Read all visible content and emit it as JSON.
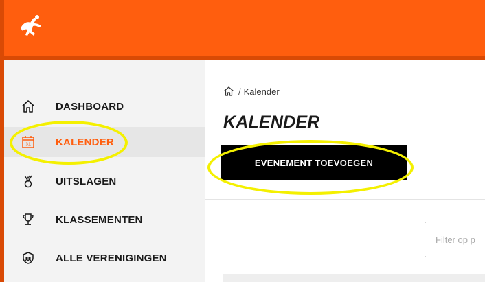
{
  "header": {
    "logo_icon": "athlete-logo-icon",
    "brand_color": "#ff5e0e"
  },
  "sidebar": {
    "items": [
      {
        "label": "DASHBOARD",
        "icon": "home-icon"
      },
      {
        "label": "KALENDER",
        "icon": "calendar-icon",
        "active": true
      },
      {
        "label": "UITSLAGEN",
        "icon": "medal-icon"
      },
      {
        "label": "KLASSEMENTEN",
        "icon": "trophy-icon"
      },
      {
        "label": "ALLE VERENIGINGEN",
        "icon": "shield-icon"
      }
    ],
    "calendar_icon_number": "31"
  },
  "breadcrumb": {
    "separator": "/",
    "current": "Kalender"
  },
  "page": {
    "title": "KALENDER",
    "add_event_label": "EVENEMENT TOEVOEGEN"
  },
  "filter": {
    "placeholder": "Filter op p"
  },
  "colors": {
    "accent": "#ff5e0e",
    "highlight": "#f4f000",
    "button_bg": "#000000"
  }
}
